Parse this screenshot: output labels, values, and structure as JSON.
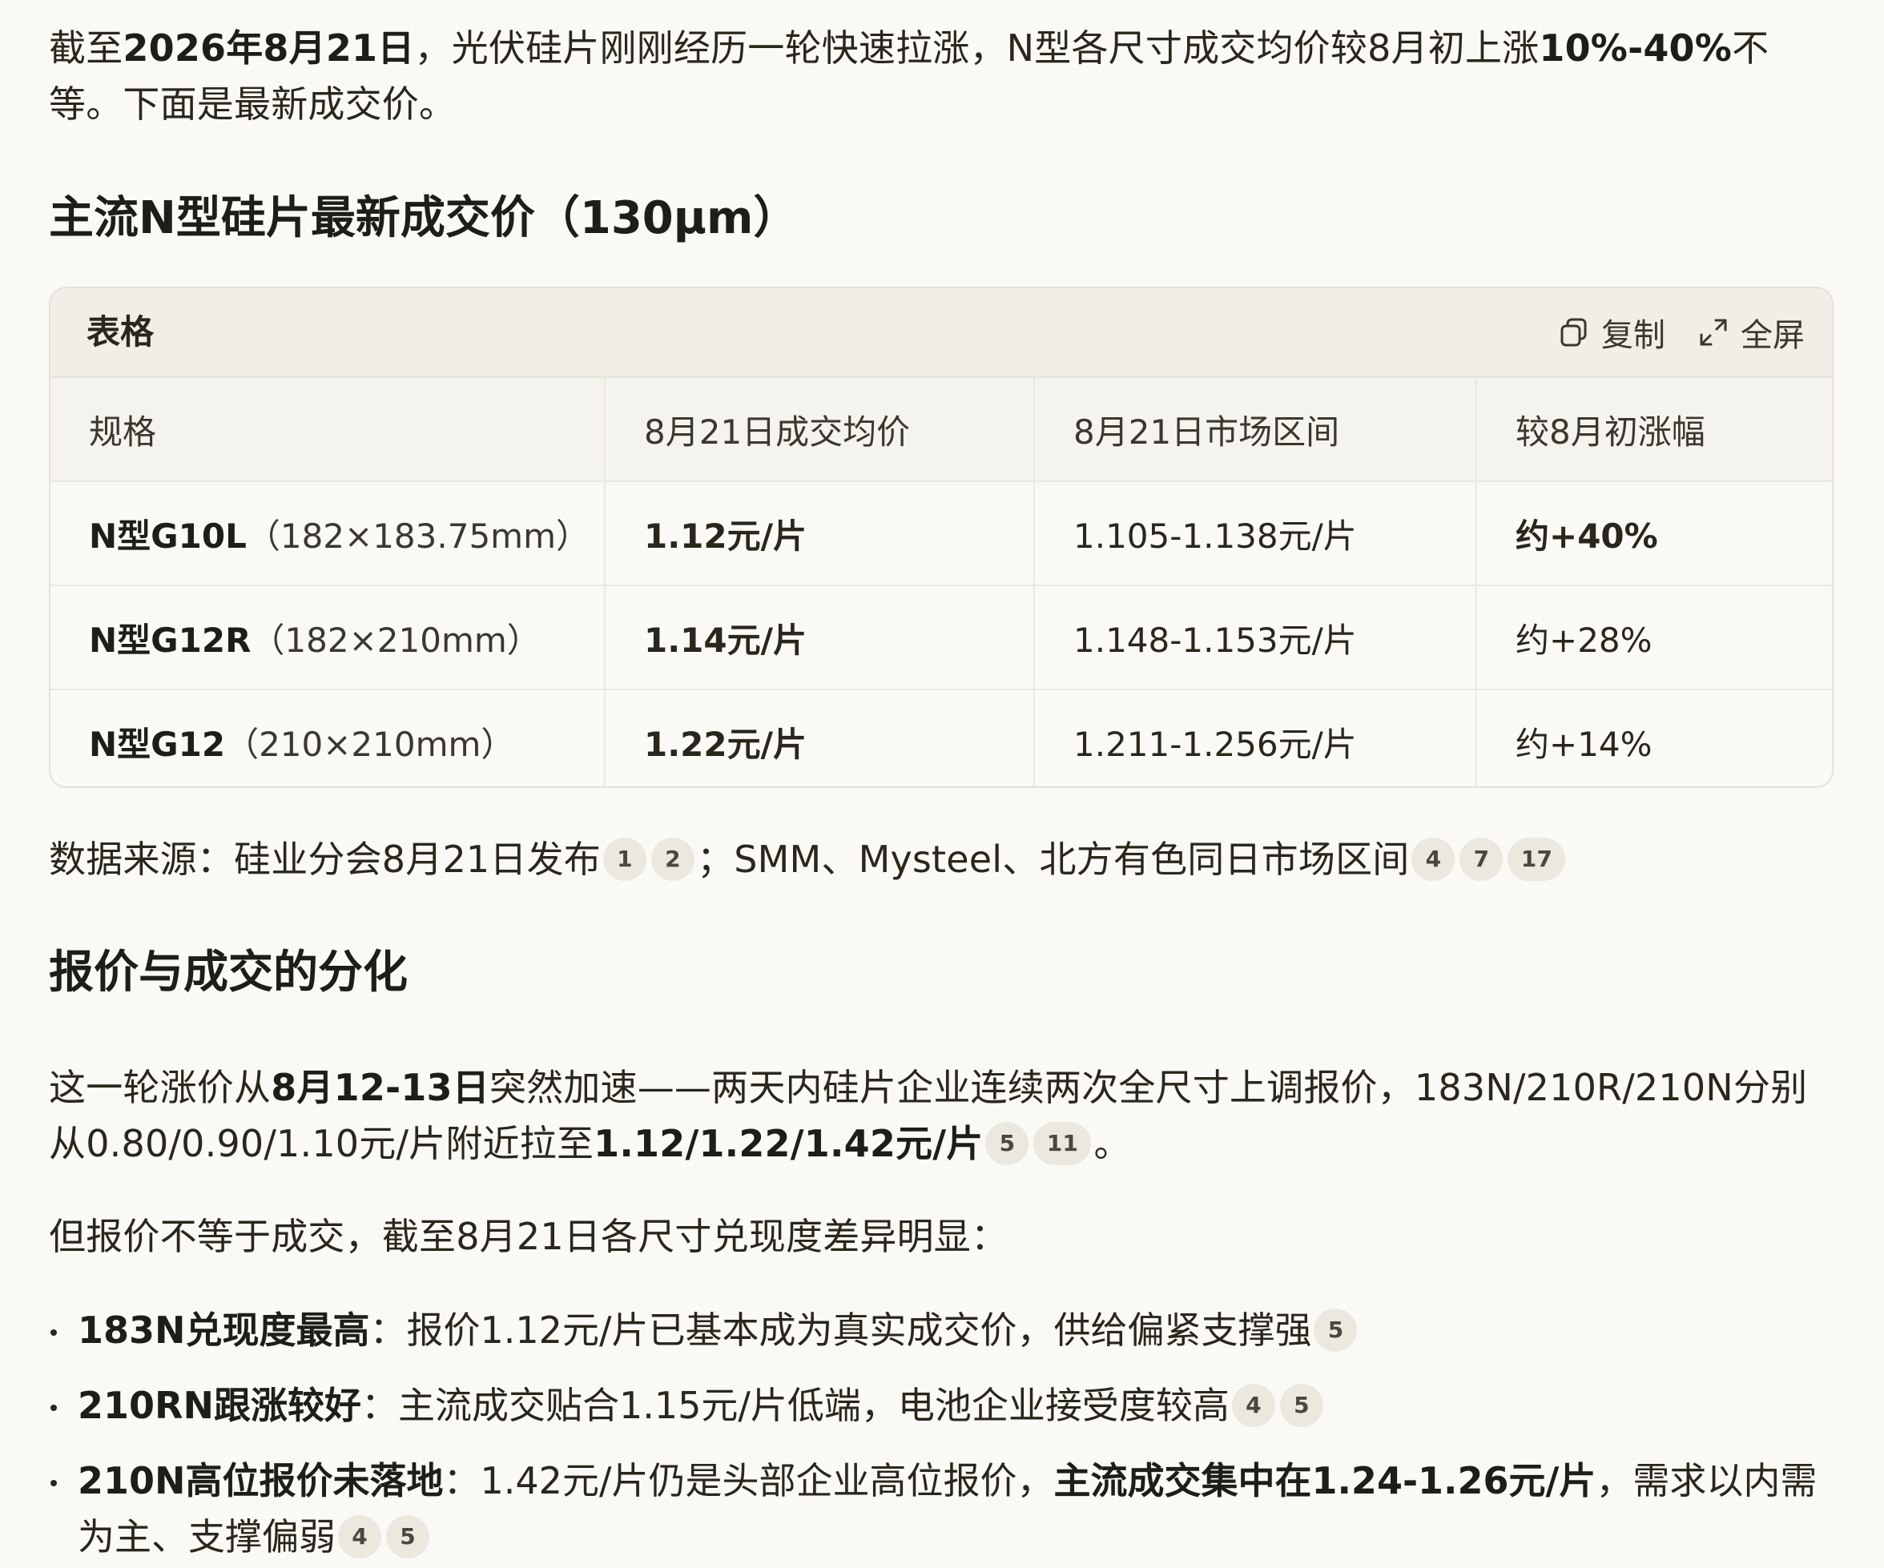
{
  "intro": {
    "p1": "截至",
    "b1": "2026年8月21日",
    "p2": "，光伏硅片刚刚经历一轮快速拉涨，N型各尺寸成交均价较8月初上涨",
    "b2": "10%-40%",
    "p3": "不等。下面是最新成交价。"
  },
  "section1_title": "主流N型硅片最新成交价（130μm）",
  "table_card": {
    "title": "表格",
    "copy_label": "复制",
    "fullscreen_label": "全屏",
    "columns": [
      "规格",
      "8月21日成交均价",
      "8月21日市场区间",
      "较8月初涨幅"
    ],
    "rows": [
      {
        "spec_name": "N型G10L",
        "spec_size": "（182×183.75mm）",
        "avg": "1.12元/片",
        "range": "1.105-1.138元/片",
        "change": "约+40%"
      },
      {
        "spec_name": "N型G12R",
        "spec_size": "（182×210mm）",
        "avg": "1.14元/片",
        "range": "1.148-1.153元/片",
        "change": "约+28%"
      },
      {
        "spec_name": "N型G12",
        "spec_size": "（210×210mm）",
        "avg": "1.22元/片",
        "range": "1.211-1.256元/片",
        "change": "约+14%"
      }
    ]
  },
  "source": {
    "p1": "数据来源：硅业分会8月21日发布",
    "sep": "；",
    "p2": "SMM、Mysteel、北方有色同日市场区间",
    "c1": "1",
    "c2": "2",
    "c4": "4",
    "c7": "7",
    "c17": "17"
  },
  "section2_title": "报价与成交的分化",
  "para2": {
    "p1": "这一轮涨价从",
    "b1": "8月12-13日",
    "p2": "突然加速——两天内硅片企业连续两次全尺寸上调报价，183N/210R/210N分别从0.80/0.90/1.10元/片附近拉至",
    "b2": "1.12/1.22/1.42元/片",
    "c5": "5",
    "c11": "11",
    "end": "。"
  },
  "para3": "但报价不等于成交，截至8月21日各尺寸兑现度差异明显：",
  "bullets": [
    {
      "bold": "183N兑现度最高",
      "text": "：报价1.12元/片已基本成为真实成交价，供给偏紧支撑强",
      "c1": "5"
    },
    {
      "bold": "210RN跟涨较好",
      "text": "：主流成交贴合1.15元/片低端，电池企业接受度较高",
      "c1": "4",
      "c2": "5"
    },
    {
      "bold": "210N高位报价未落地",
      "text": "：1.42元/片仍是头部企业高位报价，",
      "bold2": "主流成交集中在1.24-1.26元/片",
      "text2": "，需求以内需为主、支撑偏弱",
      "c1": "4",
      "c2": "5"
    }
  ]
}
